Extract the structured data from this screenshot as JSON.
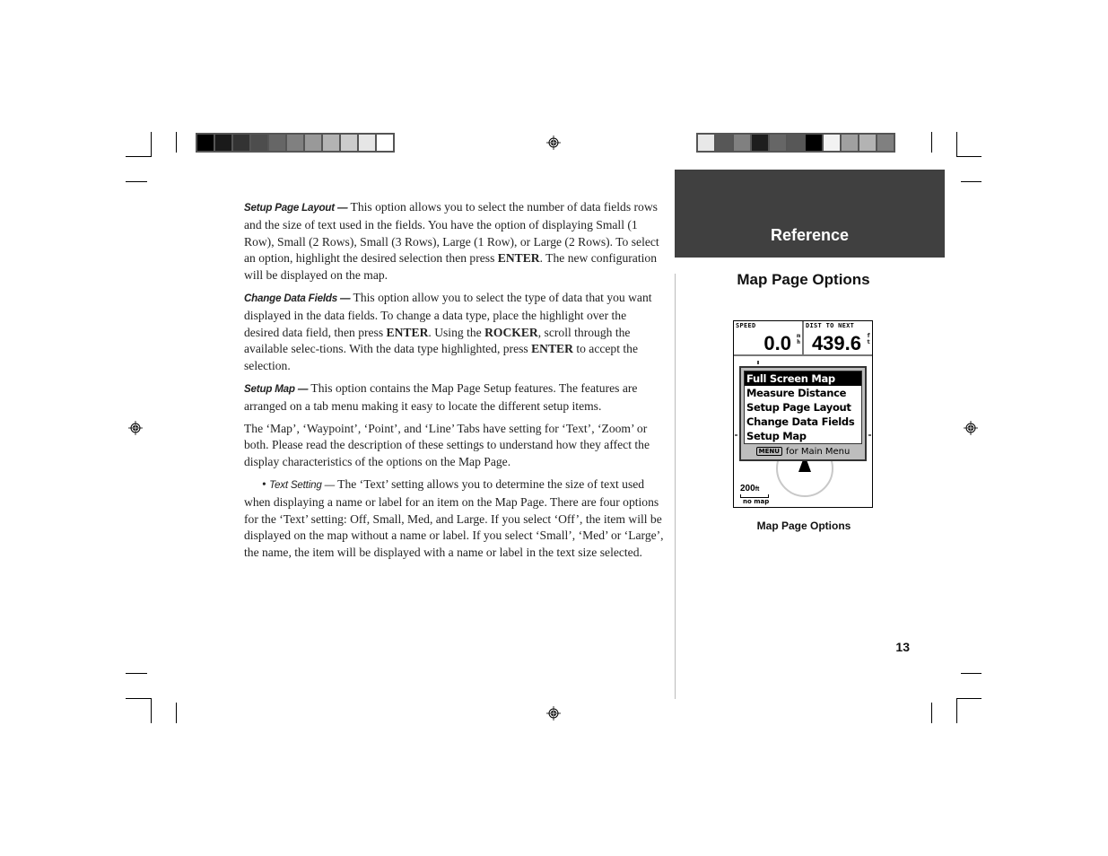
{
  "tab": {
    "label": "Reference"
  },
  "section_title": "Map Page Options",
  "body": {
    "p1": {
      "term": "Setup Page Layout —",
      "t1": " This option allows you to select the number of data fields rows and the size of text used in the fields.  You have the option of displaying Small (1 Row), Small (2 Rows), Small (3 Rows), Large (1 Row), or Large (2 Rows).  To select an option, highlight the desired selection then press ",
      "k1": "ENTER",
      "t2": ".  The new configuration will be displayed on the map."
    },
    "p2": {
      "term": "Change Data Fields —",
      "t1": " This option allow you to select the type of data that you want displayed in the data fields.  To change a data type, place the highlight over the desired data field, then press ",
      "k1": "ENTER",
      "t2": ".  Using the ",
      "k2": "ROCKER",
      "t3": ", scroll through the available selec-tions.  With the data type highlighted, press ",
      "k3": "ENTER",
      "t4": " to accept the selection."
    },
    "p3": {
      "term": "Setup Map —",
      "t1": " This option contains the Map Page Setup features.  The features are arranged on a tab menu making it easy to locate the different setup items."
    },
    "p4": {
      "t1": "The ‘Map’, ‘Waypoint’, ‘Point’, and ‘Line’ Tabs have setting for ‘Text’, ‘Zoom’ or both. Please read the description of these settings to understand how they affect the display characteristics of the options on the Map Page."
    },
    "p5": {
      "bullet": "•",
      "term": "Text Setting —",
      "t1": " The ‘Text’ setting allows you to determine the size of text used when displaying a name or label for an item on the Map Page.  There are four options for the ‘Text’ setting: Off, Small, Med, and Large.  If you select ‘Off’, the item will be displayed on the map without a name or label.  If you select ‘Small’, ‘Med’ or ‘Large’, the name, the item will be displayed with a name or label in the text size selected."
    }
  },
  "gps_screen": {
    "fields": [
      {
        "label": "SPEED",
        "value": "0.0",
        "unit_top": "m",
        "unit_bottom": "h"
      },
      {
        "label": "DIST TO NEXT",
        "value": "439.6",
        "unit_top": "f",
        "unit_bottom": "t"
      }
    ],
    "menu": {
      "items": [
        "Full Screen Map",
        "Measure Distance",
        "Setup Page Layout",
        "Change Data Fields",
        "Setup Map"
      ],
      "selected_index": 0,
      "footer_key": "MENU",
      "footer_text": "for Main Menu"
    },
    "scale": "200ft",
    "scale_value": "200",
    "scale_unit": "ft",
    "map_status": "no map"
  },
  "caption": "Map Page Options",
  "page_number": "13",
  "color_bars": {
    "left": [
      "#000000",
      "#1a1a1a",
      "#333333",
      "#4d4d4d",
      "#666666",
      "#808080",
      "#999999",
      "#b3b3b3",
      "#cccccc",
      "#e6e6e6",
      "#ffffff"
    ],
    "right": [
      "#e8e8e8",
      "#575757",
      "#808080",
      "#1e1e1e",
      "#666666",
      "#575757",
      "#000000",
      "#f2f2f2",
      "#a0a0a0",
      "#b3b3b3",
      "#808080"
    ]
  }
}
